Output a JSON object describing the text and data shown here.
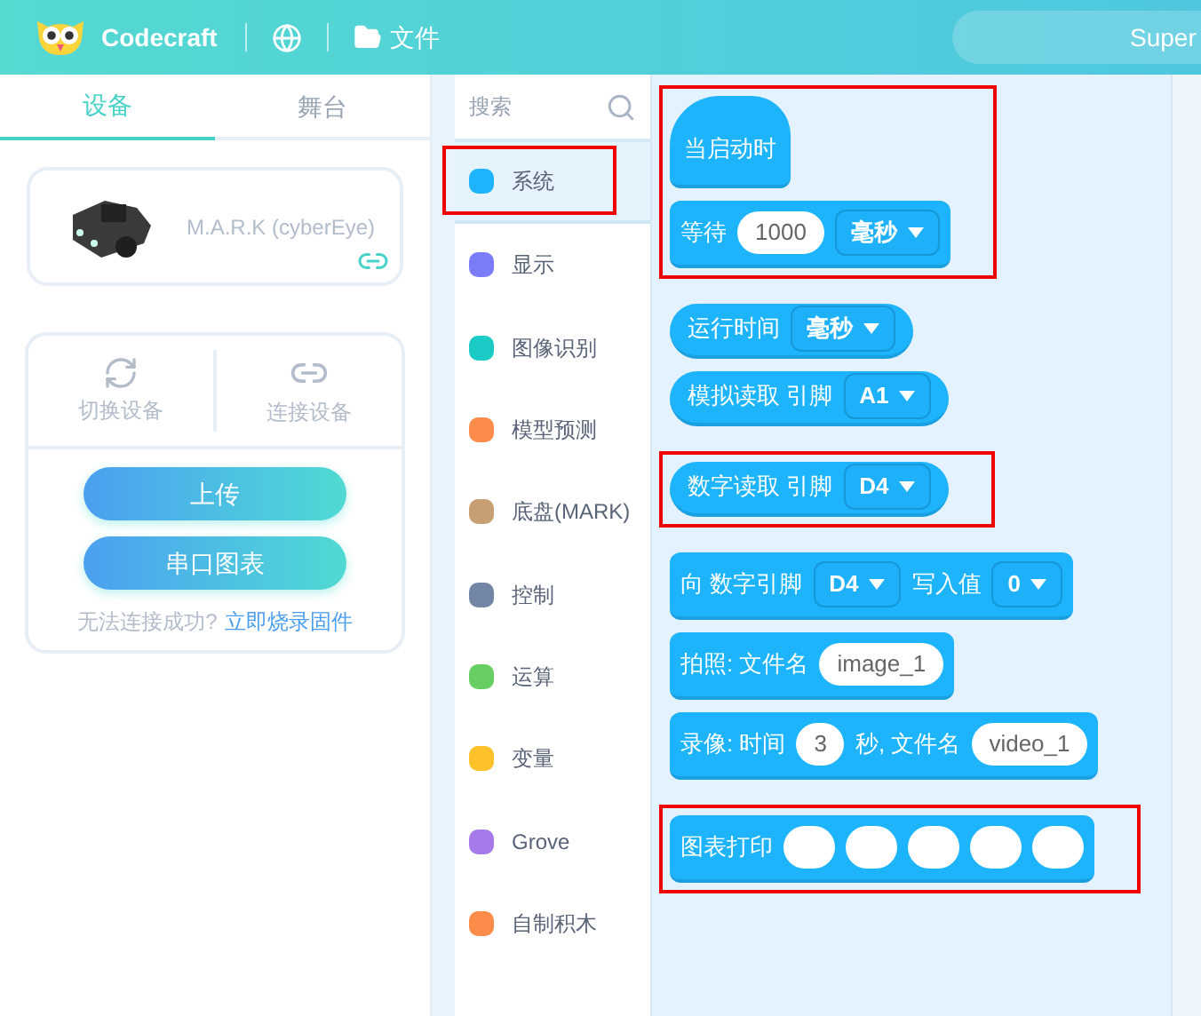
{
  "header": {
    "app_name": "Codecraft",
    "file_menu": "文件",
    "device_pill": "Super"
  },
  "left_tabs": [
    {
      "label": "设备",
      "selected": true
    },
    {
      "label": "舞台",
      "selected": false
    }
  ],
  "device": {
    "name": "M.A.R.K (cyberEye)",
    "connected": true
  },
  "actions": [
    {
      "label": "切换设备",
      "kind": "switch"
    },
    {
      "label": "连接设备",
      "kind": "connect"
    }
  ],
  "buttons": [
    "上传",
    "串口图表"
  ],
  "help": {
    "text": "无法连接成功?",
    "link": "立即烧录固件"
  },
  "search": {
    "placeholder": "搜索"
  },
  "categories": [
    {
      "label": "系统",
      "color": "#1eb4fc",
      "selected": true,
      "highlighted": true
    },
    {
      "label": "显示",
      "color": "#7b7cf7",
      "selected": false,
      "highlighted": false
    },
    {
      "label": "图像识别",
      "color": "#1ccbc6",
      "selected": false,
      "highlighted": false
    },
    {
      "label": "模型预测",
      "color": "#fd8c4a",
      "selected": false,
      "highlighted": false
    },
    {
      "label": "底盘(MARK)",
      "color": "#c89f74",
      "selected": false,
      "highlighted": false
    },
    {
      "label": "控制",
      "color": "#7285a5",
      "selected": false,
      "highlighted": false
    },
    {
      "label": "运算",
      "color": "#67cf62",
      "selected": false,
      "highlighted": false
    },
    {
      "label": "变量",
      "color": "#fdc12a",
      "selected": false,
      "highlighted": false
    },
    {
      "label": "Grove",
      "color": "#a67be9",
      "selected": false,
      "highlighted": false
    },
    {
      "label": "自制积木",
      "color": "#fd8c4a",
      "selected": false,
      "highlighted": false
    }
  ],
  "block_groups": [
    {
      "highlighted": true,
      "blocks": [
        {
          "kind": "hat",
          "parts": [
            {
              "kind": "text",
              "text": "当启动时"
            }
          ]
        },
        {
          "kind": "stack",
          "parts": [
            {
              "kind": "text",
              "text": "等待"
            },
            {
              "kind": "input",
              "text": "1000"
            },
            {
              "kind": "dropdown",
              "text": "毫秒"
            }
          ]
        }
      ]
    },
    {
      "highlighted": false,
      "blocks": [
        {
          "kind": "reporter",
          "parts": [
            {
              "kind": "text",
              "text": "运行时间"
            },
            {
              "kind": "dropdown",
              "text": "毫秒"
            }
          ]
        },
        {
          "kind": "reporter",
          "parts": [
            {
              "kind": "text",
              "text": "模拟读取 引脚"
            },
            {
              "kind": "dropdown",
              "text": "A1"
            }
          ]
        }
      ]
    },
    {
      "highlighted": true,
      "blocks": [
        {
          "kind": "reporter",
          "parts": [
            {
              "kind": "text",
              "text": "数字读取 引脚"
            },
            {
              "kind": "dropdown",
              "text": "D4"
            }
          ]
        }
      ]
    },
    {
      "highlighted": false,
      "blocks": [
        {
          "kind": "stack",
          "parts": [
            {
              "kind": "text",
              "text": "向 数字引脚"
            },
            {
              "kind": "dropdown",
              "text": "D4"
            },
            {
              "kind": "text",
              "text": "写入值"
            },
            {
              "kind": "dropdown",
              "text": "0"
            }
          ]
        },
        {
          "kind": "stack",
          "parts": [
            {
              "kind": "text",
              "text": "拍照: 文件名"
            },
            {
              "kind": "input",
              "text": "image_1"
            }
          ]
        },
        {
          "kind": "stack",
          "parts": [
            {
              "kind": "text",
              "text": "录像: 时间"
            },
            {
              "kind": "input",
              "text": "3"
            },
            {
              "kind": "text",
              "text": "秒, 文件名"
            },
            {
              "kind": "input",
              "text": "video_1"
            }
          ]
        }
      ]
    },
    {
      "highlighted": true,
      "blocks": [
        {
          "kind": "stack",
          "parts": [
            {
              "kind": "text",
              "text": "图表打印"
            },
            {
              "kind": "oval"
            },
            {
              "kind": "oval"
            },
            {
              "kind": "oval"
            },
            {
              "kind": "oval"
            },
            {
              "kind": "oval"
            }
          ]
        }
      ]
    }
  ]
}
